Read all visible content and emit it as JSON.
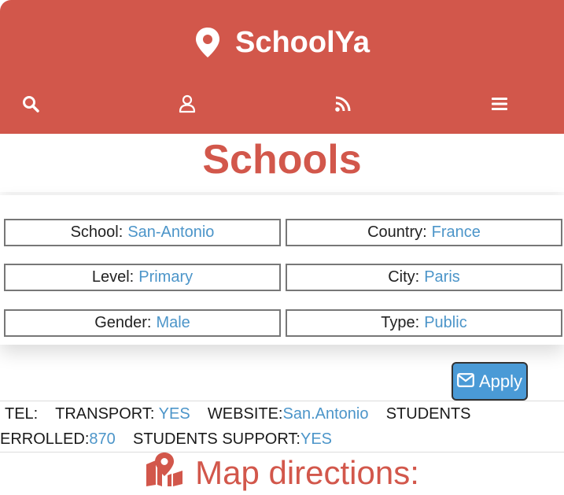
{
  "app": {
    "name": "SchoolYa"
  },
  "nav": {
    "icons": [
      "search-icon",
      "user-icon",
      "rss-icon",
      "menu-icon"
    ]
  },
  "page": {
    "title": "Schools"
  },
  "filters": {
    "school": {
      "label": "School:",
      "value": "San-Antonio"
    },
    "country": {
      "label": "Country:",
      "value": "France"
    },
    "level": {
      "label": "Level:",
      "value": "Primary"
    },
    "city": {
      "label": "City:",
      "value": "Paris"
    },
    "gender": {
      "label": "Gender:",
      "value": "Male"
    },
    "type": {
      "label": "Type:",
      "value": "Public"
    }
  },
  "apply_button": {
    "label": "Apply",
    "icon": "envelope-icon"
  },
  "info": {
    "tel_label": "TEL:",
    "transport_label": "TRANSPORT:",
    "transport_value": "YES",
    "website_label": "WEBSITE:",
    "website_value": "San.Antonio",
    "students_label": "STUDENTS",
    "enrolled_label": "ERROLLED:",
    "enrolled_value": "870",
    "support_label": "STUDENTS SUPPORT:",
    "support_value": "YES"
  },
  "map": {
    "heading": "Map directions:",
    "icon": "map-marked-icon"
  },
  "colors": {
    "brand": "#d2574b",
    "accent": "#4c95c9",
    "button": "#4a9ad6"
  }
}
